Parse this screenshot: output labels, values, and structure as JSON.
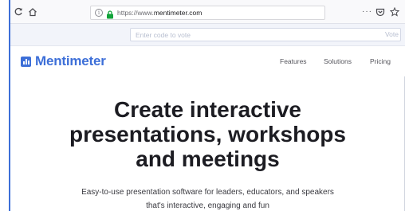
{
  "browser": {
    "url_prefix": "https://www.",
    "url_host": "mentimeter.com",
    "overflow_label": "···"
  },
  "vote_bar": {
    "input_placeholder": "Enter code to vote",
    "button_label": "Vote"
  },
  "header": {
    "logo_text": "Mentimeter",
    "brand_color": "#3d6fd8",
    "nav": [
      {
        "label": "Features"
      },
      {
        "label": "Solutions"
      },
      {
        "label": "Pricing"
      }
    ]
  },
  "hero": {
    "title_lines": [
      "Create interactive",
      "presentations, workshops",
      "and meetings"
    ],
    "subtitle_lines": [
      "Easy-to-use presentation software for leaders, educators, and speakers",
      "that's interactive, engaging and fun"
    ]
  }
}
